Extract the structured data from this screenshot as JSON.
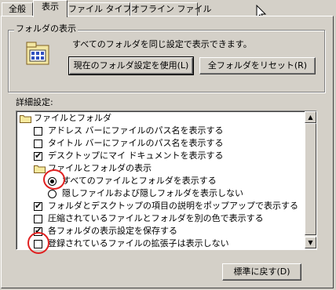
{
  "tabs": [
    "全般",
    "表示",
    "ファイル タイプ",
    "オフライン ファイル"
  ],
  "folder_view": {
    "legend": "フォルダの表示",
    "description": "すべてのフォルダを同じ設定で表示できます。",
    "apply_button": "現在のフォルダ設定を使用(L)",
    "reset_button": "全フォルダをリセット(R)"
  },
  "advanced_label": "詳細設定:",
  "tree": [
    {
      "kind": "folder",
      "label": "ファイルとフォルダ"
    },
    {
      "kind": "check",
      "checked": false,
      "label": "アドレス バーにファイルのパス名を表示する"
    },
    {
      "kind": "check",
      "checked": false,
      "label": "タイトル バーにファイルのパス名を表示する"
    },
    {
      "kind": "check",
      "checked": true,
      "label": "デスクトップにマイ ドキュメントを表示する"
    },
    {
      "kind": "folder",
      "label": "ファイルとフォルダの表示"
    },
    {
      "kind": "radio",
      "selected": true,
      "label": "すべてのファイルとフォルダを表示する"
    },
    {
      "kind": "radio",
      "selected": false,
      "label": "隠しファイルおよび隠しフォルダを表示しない"
    },
    {
      "kind": "check",
      "checked": true,
      "label": "フォルダとデスクトップの項目の説明をポップアップで表示する"
    },
    {
      "kind": "check",
      "checked": false,
      "label": "圧縮されているファイルとフォルダを別の色で表示する"
    },
    {
      "kind": "check",
      "checked": true,
      "label": "各フォルダの表示設定を保存する"
    },
    {
      "kind": "check",
      "checked": false,
      "label": "登録されているファイルの拡張子は表示しない"
    }
  ],
  "restore_button": "標準に戻す(D)",
  "colors": {
    "highlight_circle": "#e02020"
  }
}
